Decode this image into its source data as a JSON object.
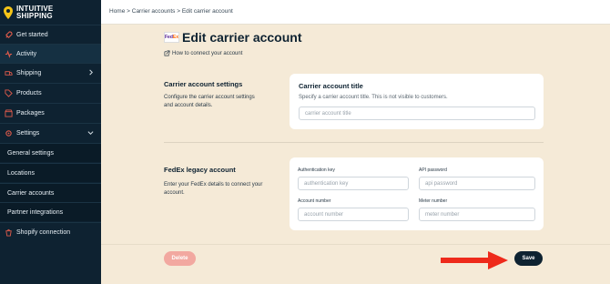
{
  "brand": {
    "line1": "INTUITIVE",
    "line2": "SHIPPING"
  },
  "sidebar": {
    "items": [
      {
        "label": "Get started",
        "icon": "rocket-icon"
      },
      {
        "label": "Activity",
        "icon": "activity-icon"
      },
      {
        "label": "Shipping",
        "icon": "truck-icon"
      },
      {
        "label": "Products",
        "icon": "tag-icon"
      },
      {
        "label": "Packages",
        "icon": "box-icon"
      },
      {
        "label": "Settings",
        "icon": "gear-icon"
      },
      {
        "label": "General settings"
      },
      {
        "label": "Locations"
      },
      {
        "label": "Carrier accounts"
      },
      {
        "label": "Partner integrations"
      },
      {
        "label": "Shopify connection",
        "icon": "shopify-icon"
      }
    ]
  },
  "breadcrumb": "Home > Carrier accounts > Edit carrier account",
  "header": {
    "logo_fed": "Fed",
    "logo_ex": "Ex",
    "title": "Edit carrier account",
    "help_link": "How to connect your account"
  },
  "section1": {
    "title": "Carrier account settings",
    "description": "Configure the carrier account settings and account details.",
    "card_title": "Carrier account title",
    "card_subtitle": "Specify a carrier account title. This is not visible to customers.",
    "input_placeholder": "carrier account title"
  },
  "section2": {
    "title": "FedEx legacy account",
    "description": "Enter your FedEx details to connect your account.",
    "fields": [
      {
        "label": "Authentication key",
        "placeholder": "authentication key"
      },
      {
        "label": "API password",
        "placeholder": "api password"
      },
      {
        "label": "Account number",
        "placeholder": "account number"
      },
      {
        "label": "Meter number",
        "placeholder": "meter number"
      }
    ]
  },
  "buttons": {
    "delete": "Delete",
    "save": "Save"
  },
  "colors": {
    "sidebar": "#0e2231",
    "page": "#f5ead7",
    "arrow": "#ee2a1b",
    "delete": "#f2a8a0",
    "save": "#0e2231"
  }
}
